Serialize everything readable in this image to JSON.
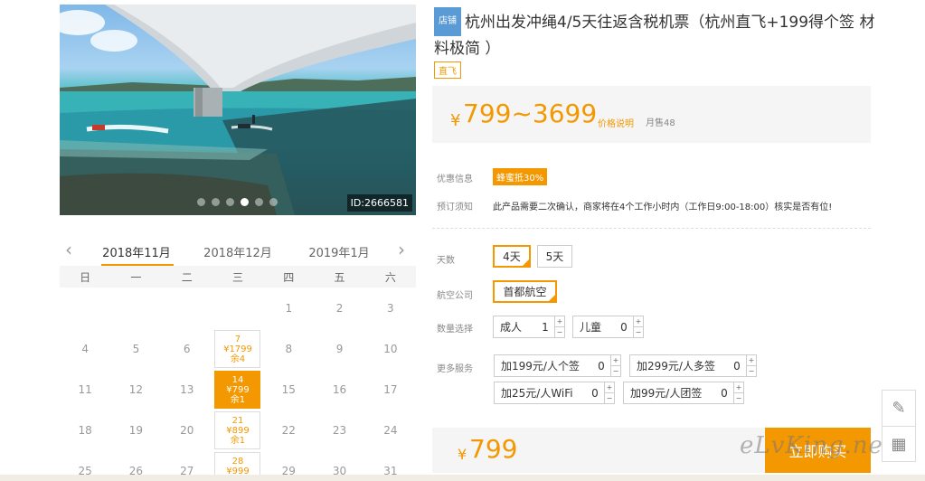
{
  "product": {
    "id_badge": "ID:2666581",
    "shop_tag": "店铺",
    "title": "杭州出发冲绳4/5天往返含税机票（杭州直飞+199得个签 材料极简 ）",
    "direct_tag": "直飞"
  },
  "price": {
    "currency": "¥",
    "range": "799~3699",
    "explain_link": "价格说明",
    "monthly_sales": "月售48"
  },
  "promo": {
    "label": "优惠信息",
    "badge": "蜂蜜抵30%"
  },
  "booking_notice": {
    "label": "预订须知",
    "text": "此产品需要二次确认，商家将在4个工作小时内（工作日9:00-18:00）核实是否有位!"
  },
  "carousel": {
    "slides": 6,
    "active": 3
  },
  "calendar": {
    "prev_arrow": "‹",
    "next_arrow": "›",
    "months": [
      "2018年11月",
      "2018年12月",
      "2019年1月"
    ],
    "active_month": 0,
    "weekdays": [
      "日",
      "一",
      "二",
      "三",
      "四",
      "五",
      "六"
    ],
    "leading_blanks": 4,
    "last_visible_day": 31,
    "offers": {
      "7": {
        "price": "¥1799",
        "stock": "余4",
        "selected": false
      },
      "14": {
        "price": "¥799",
        "stock": "余1",
        "selected": true
      },
      "21": {
        "price": "¥899",
        "stock": "余1",
        "selected": false
      },
      "28": {
        "price": "¥999",
        "stock": "",
        "selected": false
      }
    }
  },
  "options": {
    "days": {
      "label": "天数",
      "choices": [
        "4天",
        "5天"
      ],
      "selected": 0
    },
    "airline": {
      "label": "航空公司",
      "choices": [
        "首都航空"
      ],
      "selected": 0
    },
    "quantity": {
      "label": "数量选择",
      "adult": {
        "label": "成人",
        "value": "1"
      },
      "child": {
        "label": "儿童",
        "value": "0"
      }
    },
    "services": {
      "label": "更多服务",
      "items": [
        {
          "label": "加199元/人个签",
          "value": "0"
        },
        {
          "label": "加299元/人多签",
          "value": "0"
        },
        {
          "label": "加25元/人WiFi",
          "value": "0"
        },
        {
          "label": "加99元/人团签",
          "value": "0"
        }
      ]
    },
    "step_up": "+",
    "step_down": "−"
  },
  "checkout": {
    "currency": "¥",
    "total": "799",
    "buy_button": "立即购买"
  },
  "side_tools": {
    "edit_icon": "✎",
    "qr_icon": "▦"
  },
  "watermark": "eLvKing.net",
  "colors": {
    "accent": "#f39800",
    "shop_tag": "#5b9bd5",
    "panel_bg": "#f5f5f5"
  }
}
